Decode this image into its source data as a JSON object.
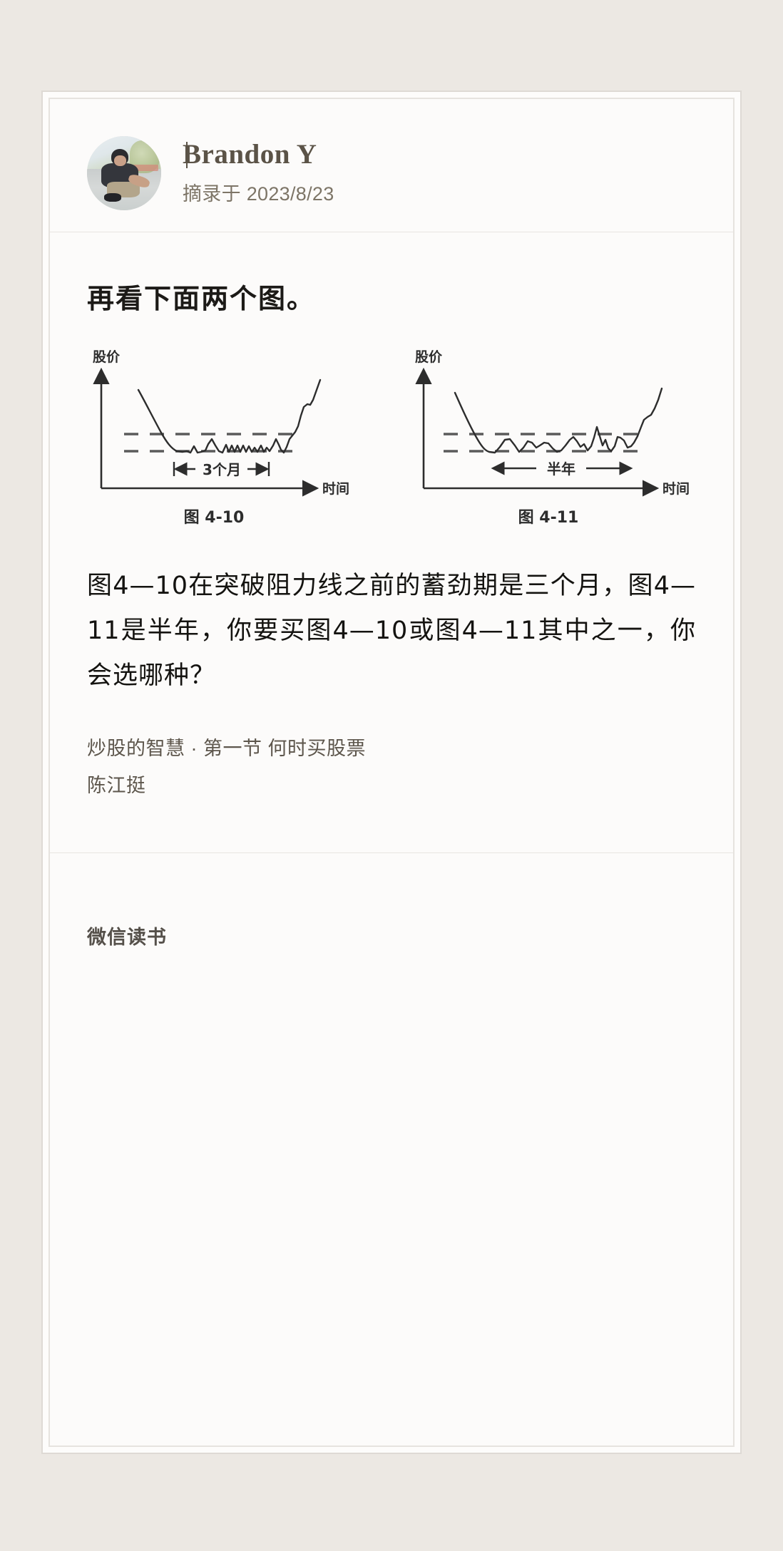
{
  "page": {
    "background_color": "#ece8e3",
    "card_background": "#fdfcfb"
  },
  "header": {
    "avatar_name": "user-avatar-photo",
    "author_name_prefix": "B",
    "author_name_rest": "randon Y",
    "author_name_full": "Brandon Y",
    "excerpt_label": "摘录于 2023/8/23"
  },
  "main": {
    "lead_text": "再看下面两个图。",
    "paragraph": "图4—10在突破阻力线之前的蓄劲期是三个月，图4—11是半年，你要买图4—10或图4—11其中之一，你会选哪种？",
    "source_line_1": "炒股的智慧 · 第一节 何时买股票",
    "source_line_2": "陈江挺"
  },
  "footer": {
    "app_name": "微信读书"
  },
  "chart_data": [
    {
      "type": "line",
      "title": "图 4-10",
      "ylabel": "股价",
      "xlabel": "时间",
      "annotation": "3个月",
      "annotation_meaning": "consolidation period of three months",
      "grid": false,
      "legend": null,
      "description": "Stock price falls steeply, consolidates sideways between two dashed resistance/support lines for 3 months, then breaks out upward.",
      "resistance_line_y": 0.42,
      "support_line_y": 0.22,
      "x": [
        0,
        4,
        8,
        12,
        16,
        20,
        22,
        24,
        26,
        28,
        30,
        32,
        34,
        36,
        38,
        40,
        42,
        44,
        46,
        48,
        50,
        52,
        54,
        56,
        58,
        60,
        62,
        64,
        66,
        68,
        70,
        72,
        76,
        80,
        84,
        88,
        92,
        96,
        100
      ],
      "values": [
        0.92,
        0.8,
        0.66,
        0.52,
        0.4,
        0.28,
        0.23,
        0.22,
        0.24,
        0.3,
        0.24,
        0.26,
        0.33,
        0.28,
        0.34,
        0.26,
        0.32,
        0.25,
        0.31,
        0.24,
        0.3,
        0.26,
        0.32,
        0.25,
        0.29,
        0.24,
        0.33,
        0.38,
        0.3,
        0.24,
        0.32,
        0.41,
        0.36,
        0.46,
        0.62,
        0.68,
        0.66,
        0.8,
        0.94
      ]
    },
    {
      "type": "line",
      "title": "图 4-11",
      "ylabel": "股价",
      "xlabel": "时间",
      "annotation": "半年",
      "annotation_meaning": "consolidation period of half a year",
      "grid": false,
      "legend": null,
      "description": "Stock price falls steeply, consolidates sideways between two dashed resistance/support lines for half a year (longer base), then breaks out upward.",
      "resistance_line_y": 0.42,
      "support_line_y": 0.22,
      "x": [
        0,
        4,
        8,
        12,
        16,
        18,
        21,
        24,
        27,
        30,
        33,
        36,
        39,
        42,
        45,
        48,
        51,
        54,
        57,
        60,
        63,
        66,
        69,
        72,
        75,
        78,
        81,
        84,
        87,
        90,
        93,
        96,
        100
      ],
      "values": [
        0.92,
        0.76,
        0.58,
        0.4,
        0.26,
        0.22,
        0.23,
        0.33,
        0.27,
        0.22,
        0.31,
        0.25,
        0.3,
        0.33,
        0.27,
        0.32,
        0.24,
        0.3,
        0.36,
        0.28,
        0.33,
        0.26,
        0.48,
        0.32,
        0.38,
        0.25,
        0.36,
        0.33,
        0.45,
        0.56,
        0.6,
        0.74,
        0.92
      ]
    }
  ]
}
